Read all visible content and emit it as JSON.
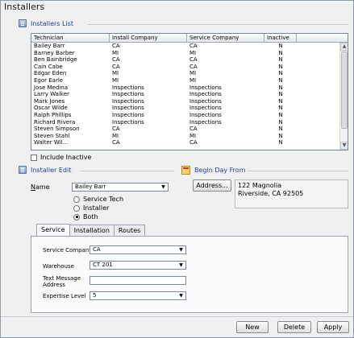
{
  "window": {
    "title": "Installers"
  },
  "installers_list": {
    "header": "Installers List",
    "columns": [
      "Technician",
      "Install Company",
      "Service Company",
      "Inactive"
    ],
    "rows": [
      [
        "Bailey Barr",
        "CA",
        "CA",
        "N"
      ],
      [
        "Barney Barber",
        "MI",
        "MI",
        "N"
      ],
      [
        "Ben Bainbridge",
        "CA",
        "CA",
        "N"
      ],
      [
        "Cain Cabe",
        "CA",
        "CA",
        "N"
      ],
      [
        "Edgar Eden",
        "MI",
        "MI",
        "N"
      ],
      [
        "Egor Earle",
        "MI",
        "MI",
        "N"
      ],
      [
        "Jose Medina",
        "Inspections",
        "Inspections",
        "N"
      ],
      [
        "Larry Walker",
        "Inspections",
        "Inspections",
        "N"
      ],
      [
        "Mark Jones",
        "Inspections",
        "Inspections",
        "N"
      ],
      [
        "Oscar Wilde",
        "Inspections",
        "Inspections",
        "N"
      ],
      [
        "Ralph Phillips",
        "Inspections",
        "Inspections",
        "N"
      ],
      [
        "Richard Rivera",
        "Inspections",
        "Inspections",
        "N"
      ],
      [
        "Steven Simpson",
        "CA",
        "CA",
        "N"
      ],
      [
        "Steven Stahl",
        "MI",
        "MI",
        "N"
      ],
      [
        "Walter Wil...",
        "CA",
        "CA",
        "N"
      ]
    ],
    "include_inactive_label": "Include Inactive"
  },
  "installer_edit": {
    "header": "Installer Edit",
    "name_label": "Name",
    "name_value": "Bailey Barr",
    "radio_options": [
      "Service Tech",
      "Installer",
      "Both"
    ],
    "selected_radio": "Both"
  },
  "begin_day_from": {
    "header": "Begin Day From",
    "address_button": "Address...",
    "address_line1": "122 Magnolia",
    "address_line2": "Riverside, CA 92505"
  },
  "tabs": [
    "Service",
    "Installation",
    "Routes"
  ],
  "active_tab": "Service",
  "service_tab": {
    "service_company_label": "Service Company",
    "service_company_value": "CA",
    "warehouse_label": "Warehouse",
    "warehouse_value": "CT 201",
    "text_message_label_1": "Text Message",
    "text_message_label_2": "Address",
    "text_message_value": "",
    "expertise_label": "Expertise Level",
    "expertise_value": "5"
  },
  "footer": {
    "new_label": "New",
    "delete_label": "Delete",
    "apply_label": "Apply"
  },
  "icons": {
    "grid": "list-icon",
    "edit": "list-icon",
    "begin_day": "calendar-icon",
    "dropdown": "chevron-down-icon"
  }
}
